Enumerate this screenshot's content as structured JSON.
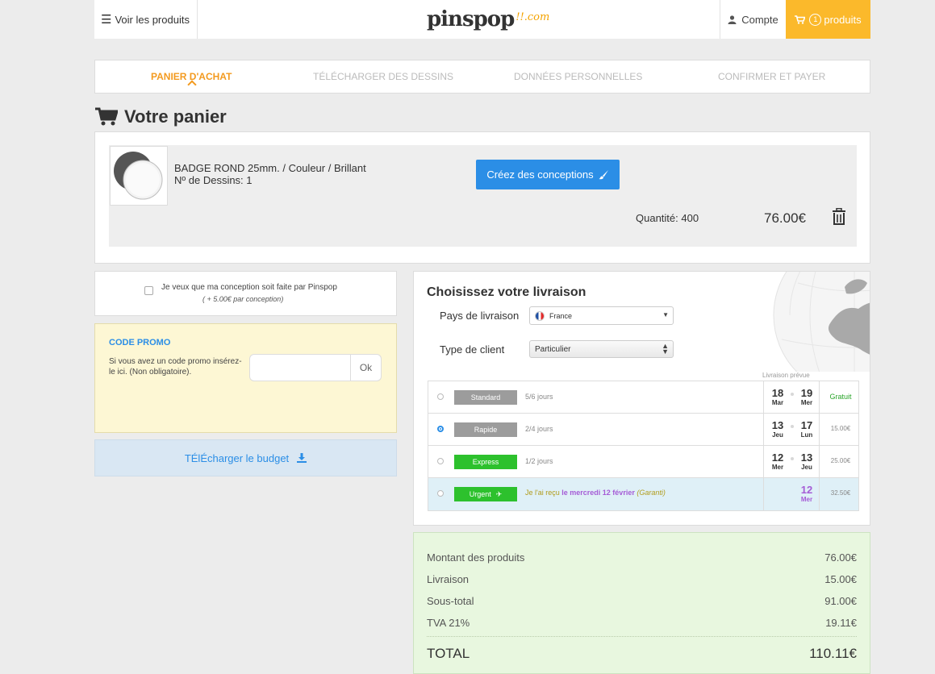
{
  "header": {
    "products_link": "Voir les produits",
    "logo_text": "pinspop",
    "logo_suffix": "!!.com",
    "account_label": "Compte",
    "cart_count": "1",
    "cart_label": "produits"
  },
  "steps": [
    {
      "label": "PANIER D'ACHAT",
      "active": true
    },
    {
      "label": "TÉLÉCHARGER DES DESSINS",
      "active": false
    },
    {
      "label": "DONNÉES PERSONNELLES",
      "active": false
    },
    {
      "label": "CONFIRMER ET PAYER",
      "active": false
    }
  ],
  "page_title": "Votre panier",
  "product": {
    "name": "BADGE ROND 25mm. / Couleur / Brillant",
    "designs": "Nº de Dessins: 1",
    "create_button": "Créez des conceptions",
    "quantity": "Quantité: 400",
    "price": "76.00€"
  },
  "design_service": {
    "label": "Je veux que ma conception soit faite par Pinspop",
    "note": "( + 5.00€ par conception)",
    "checked": false
  },
  "promo": {
    "title": "CODE PROMO",
    "text": "Si vous avez un code promo insérez-le ici. (Non obligatoire).",
    "input_value": "",
    "ok_button": "Ok"
  },
  "budget_button": "TÉlÉcharger le budget",
  "delivery": {
    "title": "Choisissez votre livraison",
    "country_label": "Pays de livraison",
    "country_value": "France",
    "client_label": "Type de client",
    "client_value": "Particulier",
    "eta_label": "Livraison prévue",
    "options": [
      {
        "name": "Standard",
        "days": "5/6 jours",
        "selected": false,
        "tag_color": "#9c9c9c",
        "date1": "18",
        "day1": "Mar",
        "date2": "19",
        "day2": "Mer",
        "price": "Gratuit"
      },
      {
        "name": "Rapide",
        "days": "2/4 jours",
        "selected": true,
        "tag_color": "#9c9c9c",
        "date1": "13",
        "day1": "Jeu",
        "date2": "17",
        "day2": "Lun",
        "price": "15.00€"
      },
      {
        "name": "Express",
        "days": "1/2 jours",
        "selected": false,
        "tag_color": "#2dc12d",
        "date1": "12",
        "day1": "Mer",
        "date2": "13",
        "day2": "Jeu",
        "price": "25.00€"
      },
      {
        "name": "Urgent",
        "text_a": "Je l'ai reçu",
        "text_b": "le mercredi 12 février",
        "text_c": "(Garanti)",
        "selected": false,
        "tag_color": "#2dc12d",
        "date1": "12",
        "day1": "Mer",
        "price": "32.50€"
      }
    ]
  },
  "totals": {
    "products_label": "Montant des produits",
    "products_value": "76.00€",
    "shipping_label": "Livraison",
    "shipping_value": "15.00€",
    "subtotal_label": "Sous-total",
    "subtotal_value": "91.00€",
    "vat_label": "TVA 21%",
    "vat_value": "19.11€",
    "total_label": "TOTAL",
    "total_value": "110.11€"
  }
}
